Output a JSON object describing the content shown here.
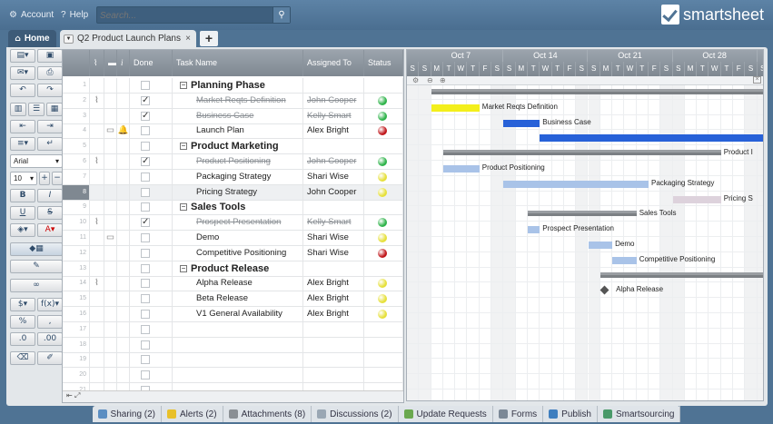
{
  "topbar": {
    "account": "Account",
    "help": "Help",
    "search_placeholder": "Search...",
    "logo_text": "smartsheet"
  },
  "tabs": {
    "home": "Home",
    "sheet": "Q2 Product Launch Plans"
  },
  "toolbar": {
    "font": "Arial",
    "size": "10"
  },
  "columns": {
    "done": "Done",
    "task": "Task Name",
    "assigned": "Assigned To",
    "status": "Status",
    "info": "i"
  },
  "rows": [
    {
      "n": "1",
      "task": "Planning Phase",
      "parent": true
    },
    {
      "n": "2",
      "task": "Market Reqts Definition",
      "assigned": "John Cooper",
      "done": true,
      "status": "green",
      "strike": true,
      "attach": true
    },
    {
      "n": "3",
      "task": "Business Case",
      "assigned": "Kelly Smart",
      "done": true,
      "status": "green",
      "strike": true
    },
    {
      "n": "4",
      "task": "Launch Plan",
      "assigned": "Alex Bright",
      "done": false,
      "status": "red",
      "comment": true,
      "alert": true
    },
    {
      "n": "5",
      "task": "Product Marketing",
      "parent": true
    },
    {
      "n": "6",
      "task": "Product Positioning",
      "assigned": "John Cooper",
      "done": true,
      "status": "green",
      "strike": true,
      "attach": true
    },
    {
      "n": "7",
      "task": "Packaging Strategy",
      "assigned": "Shari Wise",
      "done": false,
      "status": "yellow"
    },
    {
      "n": "8",
      "task": "Pricing Strategy",
      "assigned": "John Cooper",
      "done": false,
      "status": "yellow",
      "selected": true
    },
    {
      "n": "9",
      "task": "Sales Tools",
      "parent": true
    },
    {
      "n": "10",
      "task": "Prospect Presentation",
      "assigned": "Kelly Smart",
      "done": true,
      "status": "green",
      "strike": true,
      "attach": true
    },
    {
      "n": "11",
      "task": "Demo",
      "assigned": "Shari Wise",
      "done": false,
      "status": "yellow",
      "comment": true
    },
    {
      "n": "12",
      "task": "Competitive Positioning",
      "assigned": "Shari Wise",
      "done": false,
      "status": "red"
    },
    {
      "n": "13",
      "task": "Product Release",
      "parent": true
    },
    {
      "n": "14",
      "task": "Alpha Release",
      "assigned": "Alex Bright",
      "done": false,
      "status": "yellow",
      "attach": true
    },
    {
      "n": "15",
      "task": "Beta Release",
      "assigned": "Alex Bright",
      "done": false,
      "status": "yellow"
    },
    {
      "n": "16",
      "task": "V1 General Availability",
      "assigned": "Alex Bright",
      "done": false,
      "status": "yellow"
    },
    {
      "n": "17"
    },
    {
      "n": "18"
    },
    {
      "n": "19"
    },
    {
      "n": "20"
    },
    {
      "n": "21"
    }
  ],
  "gantt": {
    "weeks": [
      "Oct 7",
      "Oct 14",
      "Oct 21",
      "Oct 28"
    ],
    "days": [
      "S",
      "S",
      "M",
      "T",
      "W",
      "T",
      "F",
      "S",
      "S",
      "M",
      "T",
      "W",
      "T",
      "F",
      "S",
      "S",
      "M",
      "T",
      "W",
      "T",
      "F",
      "S",
      "S",
      "M",
      "T",
      "W",
      "T",
      "F",
      "S",
      "S"
    ],
    "labels": {
      "r2": "Market Reqts Definition",
      "r3": "Business Case",
      "r5": "Product I",
      "r6": "Product Positioning",
      "r7": "Packaging Strategy",
      "r8": "Pricing S",
      "r9": "Sales Tools",
      "r10": "Prospect Presentation",
      "r11": "Demo",
      "r12": "Competitive Positioning",
      "r14": "Alpha Release"
    }
  },
  "bottom_tabs": [
    {
      "label": "Sharing (2)",
      "color": "#5b8ec2"
    },
    {
      "label": "Alerts (2)",
      "color": "#e8c02a"
    },
    {
      "label": "Attachments (8)",
      "color": "#8a8f94"
    },
    {
      "label": "Discussions (2)",
      "color": "#9aa7b4"
    },
    {
      "label": "Update Requests",
      "color": "#6aa84f"
    },
    {
      "label": "Forms",
      "color": "#7b8896"
    },
    {
      "label": "Publish",
      "color": "#3f7fbf"
    },
    {
      "label": "Smartsourcing",
      "color": "#4a9a6a"
    }
  ],
  "colors": {
    "green": "#2eb34a",
    "yellow": "#e6e03a",
    "red": "#c0161b"
  }
}
